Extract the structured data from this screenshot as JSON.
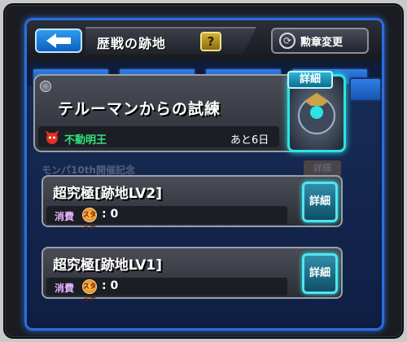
{
  "header": {
    "title": "歴戦の跡地",
    "help_label": "?",
    "swap_label": "勲章変更"
  },
  "banner": {
    "title": "テルーマンからの試練",
    "boss_name": "不動明王",
    "days_left": "あと6日",
    "detail_label": "詳細"
  },
  "ghost_row": {
    "text": "モンパ10th開催記念",
    "button": "詳細"
  },
  "quests": [
    {
      "name": "超究極[跡地LV2]",
      "cost_label": "消費",
      "stamina": "スタミナ",
      "cost": ": 0",
      "detail_label": "詳細"
    },
    {
      "name": "超究極[跡地LV1]",
      "cost_label": "消費",
      "stamina": "スタミナ",
      "cost": ": 0",
      "detail_label": "詳細"
    }
  ],
  "colors": {
    "accent_blue": "#2a6edc",
    "detail_cyan": "#4fe6f0",
    "boss_green": "#34e07a"
  }
}
